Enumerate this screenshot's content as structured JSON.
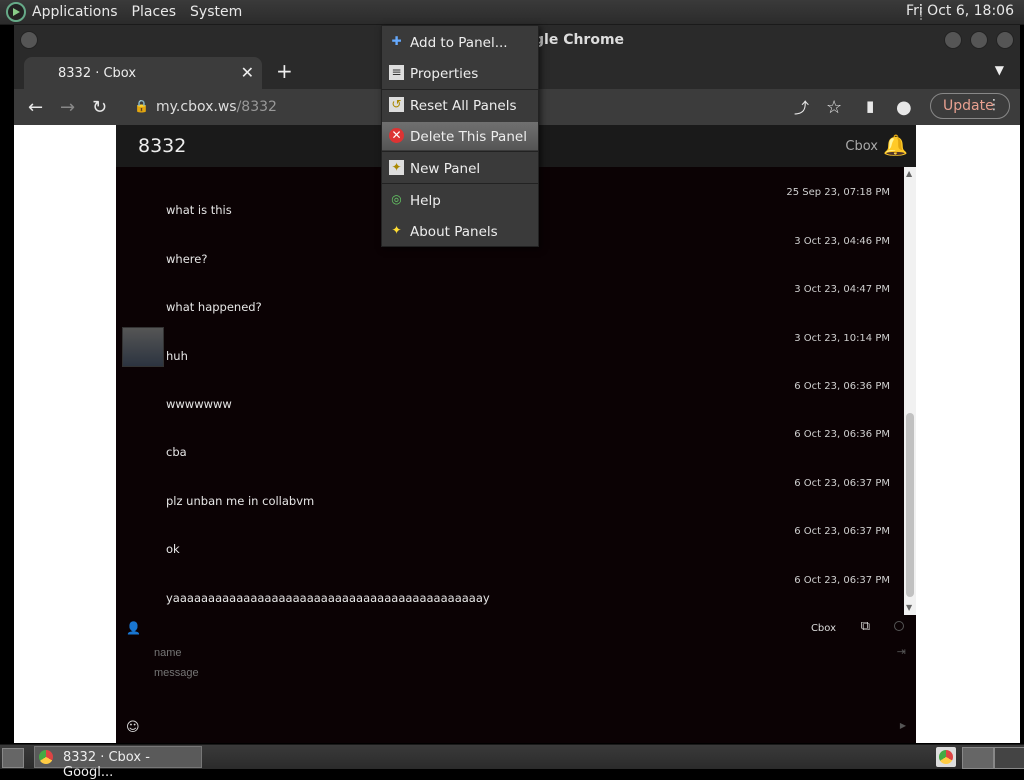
{
  "top_panel": {
    "menus": [
      "Applications",
      "Places",
      "System"
    ],
    "clock": "Fri Oct  6, 18:06"
  },
  "window": {
    "title_visible": "gle Chrome",
    "tab_title": "8332 · Cbox",
    "url_host": "my.cbox.ws",
    "url_path": "/8332",
    "update_label": "Update"
  },
  "cbox": {
    "room_name": "8332",
    "brand": "Cbox",
    "messages": [
      {
        "author": "",
        "text": "what is this",
        "time": "25 Sep 23, 07:18 PM"
      },
      {
        "author": "",
        "text": "where?",
        "time": "3 Oct 23, 04:46 PM"
      },
      {
        "author": "",
        "text": "what happened?",
        "time": "3 Oct 23, 04:47 PM"
      },
      {
        "author": "",
        "text": "huh",
        "time": "3 Oct 23, 10:14 PM"
      },
      {
        "author": "",
        "text": "wwwwwww",
        "time": "6 Oct 23, 06:36 PM"
      },
      {
        "author": "",
        "text": "cba",
        "time": "6 Oct 23, 06:36 PM"
      },
      {
        "author": "",
        "text": "plz unban me in collabvm",
        "time": "6 Oct 23, 06:37 PM"
      },
      {
        "author": "",
        "text": "ok",
        "time": "6 Oct 23, 06:37 PM"
      },
      {
        "author": "",
        "text": "yaaaaaaaaaaaaaaaaaaaaaaaaaaaaaaaaaaaaaaaaaaaay",
        "time": "6 Oct 23, 06:37 PM"
      }
    ],
    "composer": {
      "name_placeholder": "name",
      "message_placeholder": "message",
      "brand": "Cbox"
    }
  },
  "context_menu": {
    "items": [
      {
        "label": "Add to Panel...",
        "icon": "plus-icon"
      },
      {
        "label": "Properties",
        "icon": "properties-icon"
      },
      {
        "label": "Reset All Panels",
        "icon": "reset-icon"
      },
      {
        "label": "Delete This Panel",
        "icon": "delete-icon",
        "active": true
      },
      {
        "label": "New Panel",
        "icon": "new-panel-icon"
      },
      {
        "label": "Help",
        "icon": "help-icon"
      },
      {
        "label": "About Panels",
        "icon": "about-icon"
      }
    ]
  },
  "bottom_panel": {
    "taskbar_label": "8332 · Cbox - Googl..."
  }
}
